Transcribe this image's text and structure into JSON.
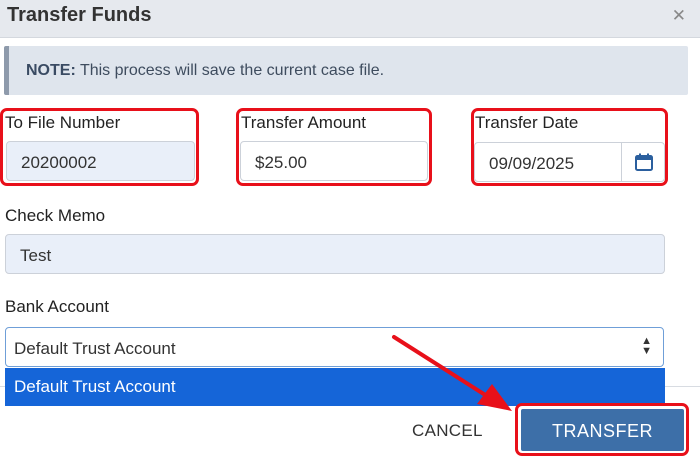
{
  "dialog": {
    "title": "Transfer Funds",
    "close_icon": "close-icon"
  },
  "note": {
    "prefix": "NOTE:",
    "text": " This process will save the current case file."
  },
  "fields": {
    "file_number": {
      "label": "To File Number",
      "value": "20200002"
    },
    "amount": {
      "label": "Transfer Amount",
      "value": "$25.00"
    },
    "date": {
      "label": "Transfer Date",
      "value": "09/09/2025",
      "icon": "calendar-icon"
    },
    "memo": {
      "label": "Check Memo",
      "value": "Test"
    },
    "bank": {
      "label": "Bank Account",
      "selected": "Default Trust Account",
      "options": [
        "Default Trust Account"
      ]
    }
  },
  "buttons": {
    "cancel": "CANCEL",
    "transfer": "TRANSFER"
  },
  "colors": {
    "highlight": "#e8101a",
    "primary": "#3d6fa8",
    "dropdown_highlight": "#1565d8"
  }
}
